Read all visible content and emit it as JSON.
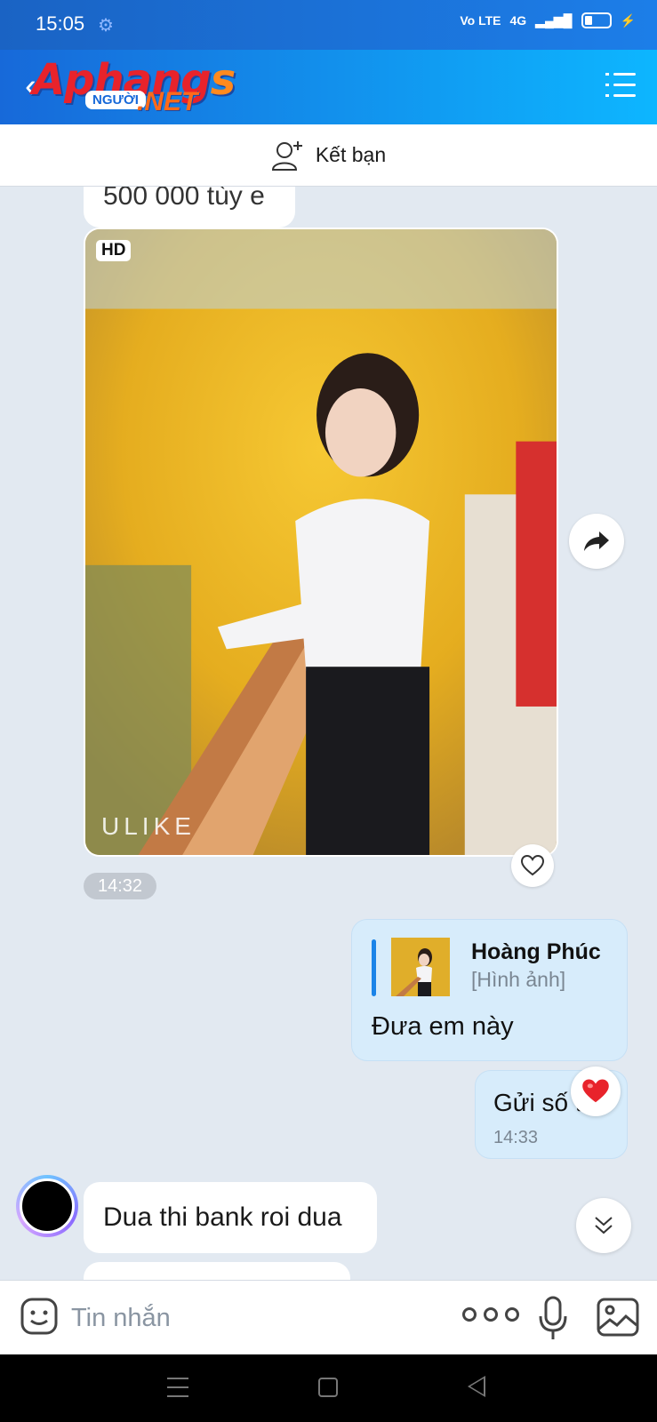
{
  "status_bar": {
    "time": "15:05",
    "network_label": "Vo LTE",
    "signal_label": "4G"
  },
  "header": {
    "logo_main": "Aphang",
    "logo_s": "s",
    "logo_sub": "NGƯỜI",
    "logo_net": ".NET",
    "back_icon": "chevron-left-icon",
    "menu_icon": "list-menu-icon"
  },
  "friend_bar": {
    "label": "Kết bạn",
    "icon": "add-friend-icon"
  },
  "messages": {
    "cut_top_text": "500 000 tùy e",
    "photo": {
      "hd_label": "HD",
      "watermark": "ULIKE",
      "time": "14:32"
    },
    "reply": {
      "quoted_name": "Hoàng Phúc",
      "quoted_type": "[Hình ảnh]",
      "text": "Đưa em này"
    },
    "sent_second": {
      "text": "Gửi số tk",
      "time": "14:33",
      "reaction": "heart"
    },
    "received_first": {
      "text": "Dua thi bank roi dua"
    }
  },
  "input_bar": {
    "placeholder": "Tin nhắn",
    "value": ""
  },
  "colors": {
    "header_start": "#1769d9",
    "header_end": "#0db6ff",
    "chat_background": "#e2e9f1",
    "sent_bubble": "#d7ecfb",
    "reaction_heart": "#e8232b"
  }
}
